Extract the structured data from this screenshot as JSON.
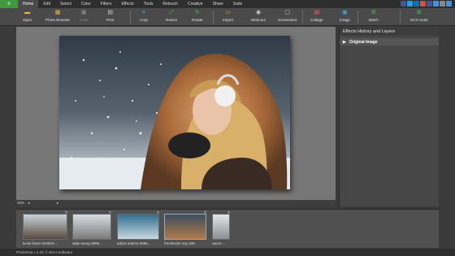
{
  "menu": {
    "items": [
      "Home",
      "Edit",
      "Select",
      "Color",
      "Filters",
      "Effects",
      "Tools",
      "Retouch",
      "Creative",
      "Share",
      "Suite"
    ],
    "active": "Home"
  },
  "toolbar": {
    "tools": [
      {
        "label": "Open",
        "icon": "folder-icon",
        "color": "#e8b93a"
      },
      {
        "label": "Photo Browser",
        "icon": "photo-browser-icon",
        "color": "#e8b93a"
      },
      {
        "label": "Save",
        "icon": "save-icon",
        "color": "#8a8a8a",
        "disabled": true
      },
      {
        "label": "Print",
        "icon": "print-icon",
        "color": "#cfcfcf"
      },
      {
        "label": "Crop",
        "icon": "crop-icon",
        "color": "#4aa0e0"
      },
      {
        "label": "Resize",
        "icon": "resize-icon",
        "color": "#3fbf6a"
      },
      {
        "label": "Rotate",
        "icon": "rotate-icon",
        "color": "#3fbf6a"
      },
      {
        "label": "Import",
        "icon": "import-icon",
        "color": "#e0a030"
      },
      {
        "label": "Webcam",
        "icon": "webcam-icon",
        "color": "#cfcfcf"
      },
      {
        "label": "Screenshot",
        "icon": "screenshot-icon",
        "color": "#cfcfcf"
      },
      {
        "label": "Collage",
        "icon": "collage-icon",
        "color": "#e05050"
      },
      {
        "label": "Image",
        "icon": "image-icon",
        "color": "#4aa0e0"
      },
      {
        "label": "Batch",
        "icon": "batch-icon",
        "color": "#3fbf6a"
      },
      {
        "label": "NCH Suite",
        "icon": "nch-suite-icon",
        "color": "#3fbf6a"
      }
    ]
  },
  "panel": {
    "title": "Effects History and Layers",
    "row_label": "Original Image"
  },
  "zoom": {
    "value": "33%"
  },
  "filmstrip": {
    "thumbs": [
      {
        "label": "lucas-favre-534604-...",
        "colors": [
          "#c9d3db",
          "#5a4a40"
        ]
      },
      {
        "label": "alain-wong-5985...",
        "colors": [
          "#d8dde2",
          "#7a7a7a"
        ]
      },
      {
        "label": "adam-adams-5595...",
        "colors": [
          "#2f6f8f",
          "#c8d8e0"
        ]
      },
      {
        "label": "freestocks-org-188...",
        "colors": [
          "#3c4e60",
          "#b07a4a"
        ],
        "selected": true
      },
      {
        "label": "aaron-...",
        "colors": [
          "#e2e6ea",
          "#8a8f95"
        ]
      }
    ]
  },
  "status": {
    "text": "PhotoPad v 4.02 © NCH Software"
  },
  "colors": {
    "accent": "#3f9a3f",
    "social": [
      "#3b5998",
      "#1da1f2",
      "#0077b5",
      "#dd4b39",
      "#3b5998",
      "#4a90d9",
      "#888888",
      "#4a90d9"
    ]
  }
}
